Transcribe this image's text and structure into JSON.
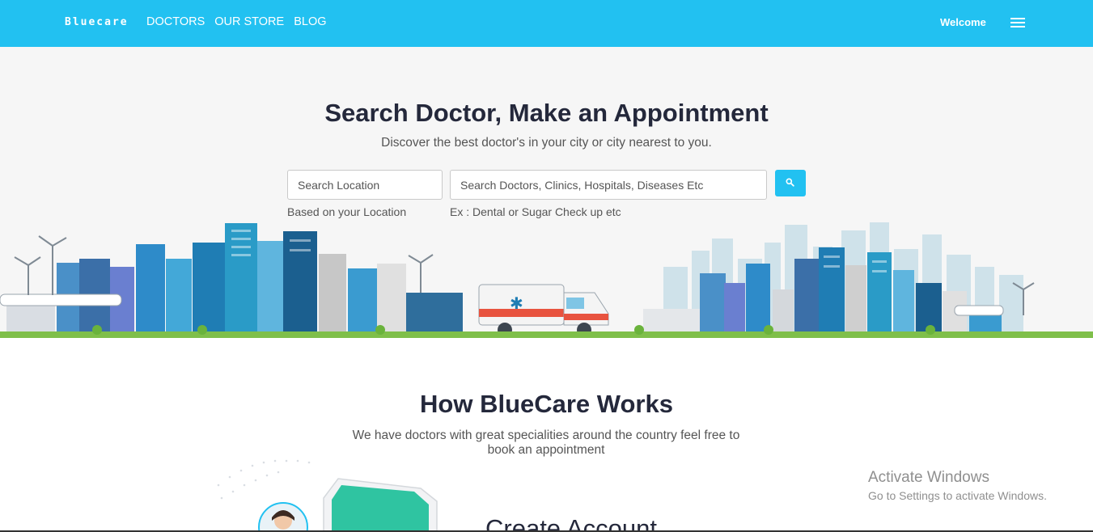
{
  "navbar": {
    "brand": "Bluecare",
    "links": [
      "DOCTORS",
      "OUR STORE",
      "BLOG"
    ],
    "welcome": "Welcome",
    "bg_color": "#22c1f1"
  },
  "hero": {
    "title": "Search Doctor, Make an Appointment",
    "subtitle": "Discover the best doctor's in your city or city nearest to you.",
    "location_placeholder": "Search Location",
    "query_placeholder": "Search Doctors, Clinics, Hospitals, Diseases Etc",
    "location_hint": "Based on your Location",
    "query_hint": "Ex : Dental or Sugar Check up etc",
    "search_icon": "search-icon"
  },
  "how": {
    "title": "How BlueCare Works",
    "subtitle": "We have doctors with great specialities around the country feel free to book an appointment",
    "next_heading": "Create Account"
  },
  "watermark": {
    "title": "Activate Windows",
    "subtitle": "Go to Settings to activate Windows."
  },
  "colors": {
    "accent": "#22c1f1",
    "heading": "#24283b",
    "ambulance_red": "#e8533f"
  }
}
